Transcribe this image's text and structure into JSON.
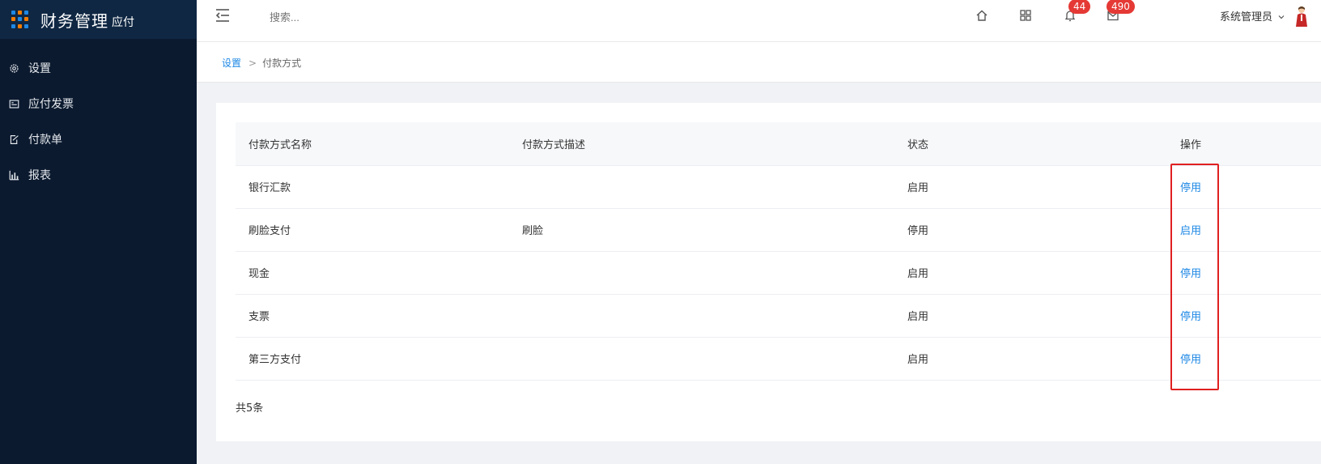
{
  "brand": {
    "title": "财务管理",
    "subtitle": "应付"
  },
  "sidebar": {
    "items": [
      {
        "label": "设置",
        "icon": "gear-icon"
      },
      {
        "label": "应付发票",
        "icon": "invoice-icon"
      },
      {
        "label": "付款单",
        "icon": "edit-doc-icon"
      },
      {
        "label": "报表",
        "icon": "bar-chart-icon"
      }
    ]
  },
  "header": {
    "search_placeholder": "搜索...",
    "notifications_count": "44",
    "messages_count": "490",
    "user_name": "系统管理员"
  },
  "breadcrumb": {
    "parent": "设置",
    "separator": ">",
    "current": "付款方式"
  },
  "table": {
    "columns": [
      "付款方式名称",
      "付款方式描述",
      "状态",
      "操作"
    ],
    "rows": [
      {
        "name": "银行汇款",
        "desc": "",
        "status": "启用",
        "action": "停用"
      },
      {
        "name": "刷脸支付",
        "desc": "刷脸",
        "status": "停用",
        "action": "启用"
      },
      {
        "name": "现金",
        "desc": "",
        "status": "启用",
        "action": "停用"
      },
      {
        "name": "支票",
        "desc": "",
        "status": "启用",
        "action": "停用"
      },
      {
        "name": "第三方支付",
        "desc": "",
        "status": "启用",
        "action": "停用"
      }
    ]
  },
  "footer": {
    "total": "共5条"
  },
  "colors": {
    "sidebar_bg": "#0b1a2f",
    "link": "#1e88e5",
    "badge": "#e53935",
    "highlight": "#e02020"
  }
}
